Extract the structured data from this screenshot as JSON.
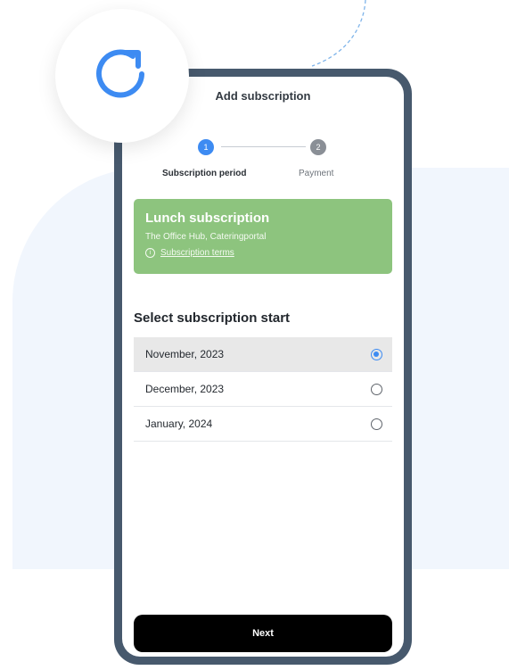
{
  "header": {
    "title": "Add subscription"
  },
  "stepper": {
    "steps": [
      {
        "number": "1",
        "label": "Subscription period",
        "active": true
      },
      {
        "number": "2",
        "label": "Payment",
        "active": false
      }
    ]
  },
  "subscription_card": {
    "title": "Lunch subscription",
    "subtitle": "The Office Hub, Cateringportal",
    "terms_link": "Subscription terms",
    "color": "#8dc47e"
  },
  "start_selection": {
    "title": "Select subscription start",
    "options": [
      {
        "label": "November, 2023",
        "selected": true
      },
      {
        "label": "December, 2023",
        "selected": false
      },
      {
        "label": "January, 2024",
        "selected": false
      }
    ]
  },
  "actions": {
    "next_label": "Next"
  },
  "icons": {
    "badge": "refresh-icon",
    "info": "info-icon"
  },
  "colors": {
    "accent": "#3d8bf2",
    "phone_frame": "#47596d",
    "button": "#000000"
  }
}
